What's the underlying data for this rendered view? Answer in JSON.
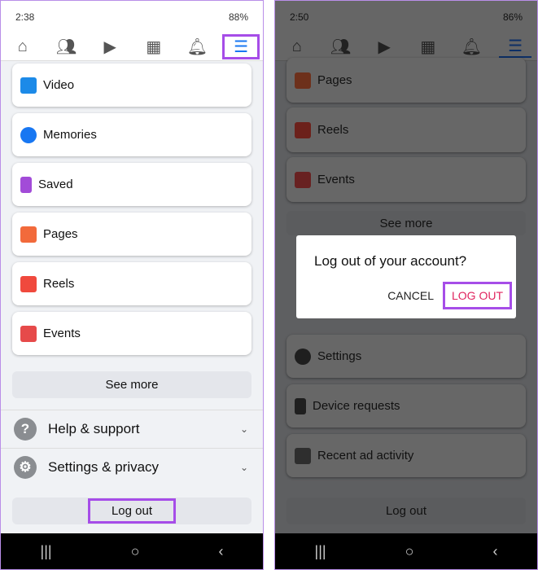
{
  "left": {
    "status": {
      "time": "2:38",
      "battery": "88%"
    },
    "nav": [
      "home-icon",
      "friends-icon",
      "video-icon",
      "marketplace-icon",
      "bell-icon",
      "menu-icon"
    ],
    "items": [
      {
        "label": "Video",
        "color": "#1c8ae8"
      },
      {
        "label": "Memories",
        "color": "#1877f2"
      },
      {
        "label": "Saved",
        "color": "#a24bd8"
      },
      {
        "label": "Pages",
        "color": "#f26a3b"
      },
      {
        "label": "Reels",
        "color": "#f0493d"
      },
      {
        "label": "Events",
        "color": "#e64a4a"
      }
    ],
    "see_more": "See more",
    "help": "Help & support",
    "settings": "Settings & privacy",
    "logout": "Log out"
  },
  "right": {
    "status": {
      "time": "2:50",
      "battery": "86%"
    },
    "items": [
      {
        "label": "Pages"
      },
      {
        "label": "Reels"
      },
      {
        "label": "Events"
      }
    ],
    "see_more": "See more",
    "items2": [
      {
        "label": "Settings"
      },
      {
        "label": "Device requests"
      },
      {
        "label": "Recent ad activity"
      }
    ],
    "logout": "Log out",
    "dialog": {
      "title": "Log out of your account?",
      "cancel": "CANCEL",
      "confirm": "LOG OUT",
      "confirm_color": "#e0245e"
    }
  }
}
